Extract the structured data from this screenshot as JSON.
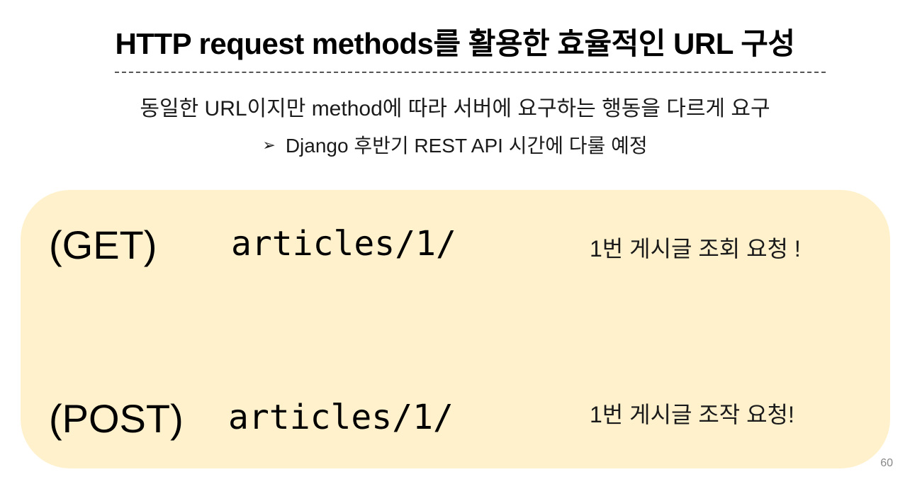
{
  "slide": {
    "title": "HTTP request methods를 활용한 효율적인 URL 구성",
    "subtitle": "동일한 URL이지만 method에 따라 서버에 요구하는 행동을 다르게 요구",
    "bullet": {
      "icon": "arrowhead-bullet-icon",
      "glyph": "➢",
      "text": "Django 후반기 REST API 시간에 다룰 예정"
    },
    "examples": [
      {
        "method": "(GET)",
        "path": "articles/1/",
        "description": "1번 게시글 조회 요청 !"
      },
      {
        "method": "(POST)",
        "path": "articles/1/",
        "description": "1번 게시글 조작 요청!"
      }
    ],
    "page_number": "60"
  },
  "colors": {
    "panel_background": "#fff1cc",
    "text": "#000000",
    "divider": "#555555",
    "page_number": "#888888"
  }
}
